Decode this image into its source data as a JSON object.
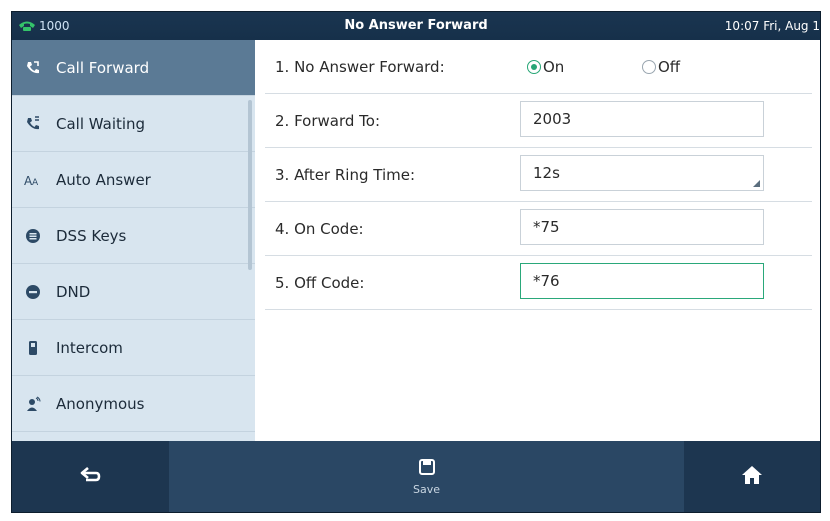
{
  "topbar": {
    "line": "1000",
    "title": "No Answer Forward",
    "clock": "10:07 Fri, Aug 1"
  },
  "sidebar": {
    "items": [
      {
        "label": "Call Forward",
        "icon": "call-forward-icon",
        "active": true
      },
      {
        "label": "Call Waiting",
        "icon": "call-waiting-icon",
        "active": false
      },
      {
        "label": "Auto Answer",
        "icon": "auto-answer-icon",
        "active": false
      },
      {
        "label": "DSS Keys",
        "icon": "dss-keys-icon",
        "active": false
      },
      {
        "label": "DND",
        "icon": "dnd-icon",
        "active": false
      },
      {
        "label": "Intercom",
        "icon": "intercom-icon",
        "active": false
      },
      {
        "label": "Anonymous",
        "icon": "anonymous-icon",
        "active": false
      }
    ]
  },
  "form": {
    "no_answer_forward": {
      "label": "1. No Answer Forward:",
      "on_label": "On",
      "off_label": "Off",
      "selected": "On"
    },
    "forward_to": {
      "label": "2. Forward To:",
      "value": "2003"
    },
    "after_ring_time": {
      "label": "3. After Ring Time:",
      "value": "12s"
    },
    "on_code": {
      "label": "4. On Code:",
      "value": "*75"
    },
    "off_code": {
      "label": "5. Off Code:",
      "value": "*76"
    }
  },
  "softkeys": {
    "back": {
      "icon": "back-arrow-icon"
    },
    "save": {
      "icon": "save-icon",
      "label": "Save"
    },
    "home": {
      "icon": "home-icon"
    }
  },
  "colors": {
    "accent": "#27a676",
    "sidebar_active": "#5b7a95",
    "chrome": "#1d3650"
  }
}
